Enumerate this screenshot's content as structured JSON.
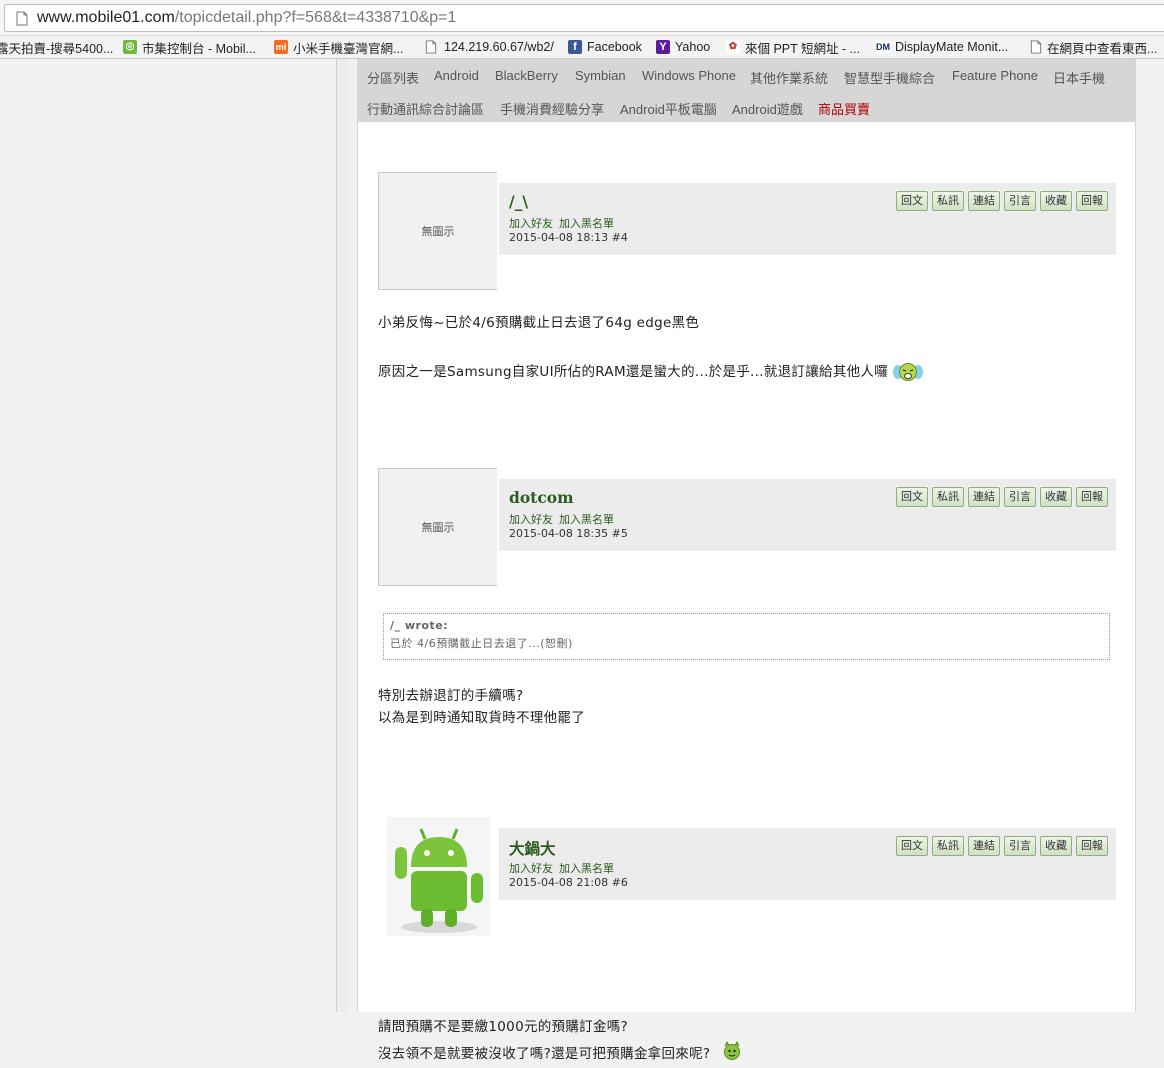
{
  "browser": {
    "url_host": "www.mobile01.com",
    "url_path": "/topicdetail.php?f=568&t=4338710&p=1",
    "bookmarks": [
      {
        "label": "露天拍賣-搜尋5400...",
        "icon": "auction-icon"
      },
      {
        "label": "市集控制台 - Mobil...",
        "icon": "market-icon",
        "color": "#6dbb3a"
      },
      {
        "label": "小米手機臺灣官網...",
        "icon": "mi-icon",
        "color": "#f36c21"
      },
      {
        "label": "124.219.60.67/wb2/",
        "icon": "page-icon"
      },
      {
        "label": "Facebook",
        "icon": "facebook-icon",
        "color": "#3b5998"
      },
      {
        "label": "Yahoo",
        "icon": "yahoo-icon",
        "color": "#5b1c9b"
      },
      {
        "label": "來個 PPT 短網址 - ...",
        "icon": "ppt-icon"
      },
      {
        "label": "DisplayMate Monit...",
        "icon": "displaymate-icon"
      },
      {
        "label": "在網頁中查看東西...",
        "icon": "page-icon"
      }
    ]
  },
  "forum_nav": {
    "row1": [
      "分區列表",
      "Android",
      "BlackBerry",
      "Symbian",
      "Windows Phone",
      "其他作業系統",
      "智慧型手機綜合",
      "Feature Phone",
      "日本手機"
    ],
    "row2": [
      "行動通訊綜合討論區",
      "手機消費經驗分享",
      "Android平板電腦",
      "Android遊戲",
      "商品買賣"
    ]
  },
  "post_actions": [
    "回文",
    "私訊",
    "連結",
    "引言",
    "收藏",
    "回報"
  ],
  "friend_links": {
    "add_friend": "加入好友",
    "blacklist": "加入黑名單"
  },
  "no_avatar_text": "無圖示",
  "posts": [
    {
      "username": "/_\\",
      "meta": "2015-04-08 18:13  #4",
      "body": [
        "小弟反悔~已於4/6預購截止日去退了64g edge黑色",
        "原因之一是Samsung自家UI所佔的RAM還是蠻大的...於是乎...就退訂讓給其他人囉"
      ]
    },
    {
      "username": "dotcom",
      "meta": "2015-04-08 18:35  #5",
      "quote_header": "/_ wrote:",
      "quote_body": "已於 4/6預購截止日去退了...(恕刪)",
      "body": [
        "特別去辦退訂的手續嗎?",
        "以為是到時通知取貨時不理他罷了"
      ]
    },
    {
      "username": "大鍋大",
      "meta": "2015-04-08 21:08  #6",
      "body": [
        "請問預購不是要繳1000元的預購訂金嗎?",
        "沒去領不是就要被沒收了嗎?還是可把預購金拿回來呢?"
      ]
    }
  ],
  "colors": {
    "username_green": "#2c5b1e",
    "nav_red": "#b30000",
    "nav_bg": "#d6d6d6",
    "post_header_bg": "#ececec"
  }
}
